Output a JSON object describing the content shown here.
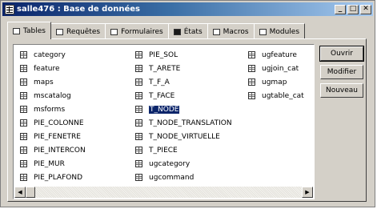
{
  "window": {
    "title": "salle476 : Base de données"
  },
  "titlebar_buttons": {
    "minimize": "_",
    "maximize": "□",
    "close": "✕"
  },
  "tabs": [
    {
      "label": "Tables",
      "icon": "table-icon",
      "active": true
    },
    {
      "label": "Requêtes",
      "icon": "query-icon",
      "active": false
    },
    {
      "label": "Formulaires",
      "icon": "form-icon",
      "active": false
    },
    {
      "label": "États",
      "icon": "report-icon",
      "active": false
    },
    {
      "label": "Macros",
      "icon": "macro-icon",
      "active": false
    },
    {
      "label": "Modules",
      "icon": "module-icon",
      "active": false
    }
  ],
  "tables": {
    "columns": [
      [
        "category",
        "feature",
        "maps",
        "mscatalog",
        "msforms",
        "PIE_COLONNE",
        "PIE_FENETRE",
        "PIE_INTERCON",
        "PIE_MUR",
        "PIE_PLAFOND"
      ],
      [
        "PIE_SOL",
        "T_ARETE",
        "T_F_A",
        "T_FACE",
        "T_NODE",
        "T_NODE_TRANSLATION",
        "T_NODE_VIRTUELLE",
        "T_PIECE",
        "ugcategory",
        "ugcommand"
      ],
      [
        "ugfeature",
        "ugjoin_cat",
        "ugmap",
        "ugtable_cat"
      ]
    ],
    "selected": "T_NODE"
  },
  "buttons": {
    "open": "Ouvrir",
    "modify": "Modifier",
    "new": "Nouveau"
  },
  "scrollbar": {
    "left_arrow": "◀",
    "right_arrow": "▶"
  }
}
